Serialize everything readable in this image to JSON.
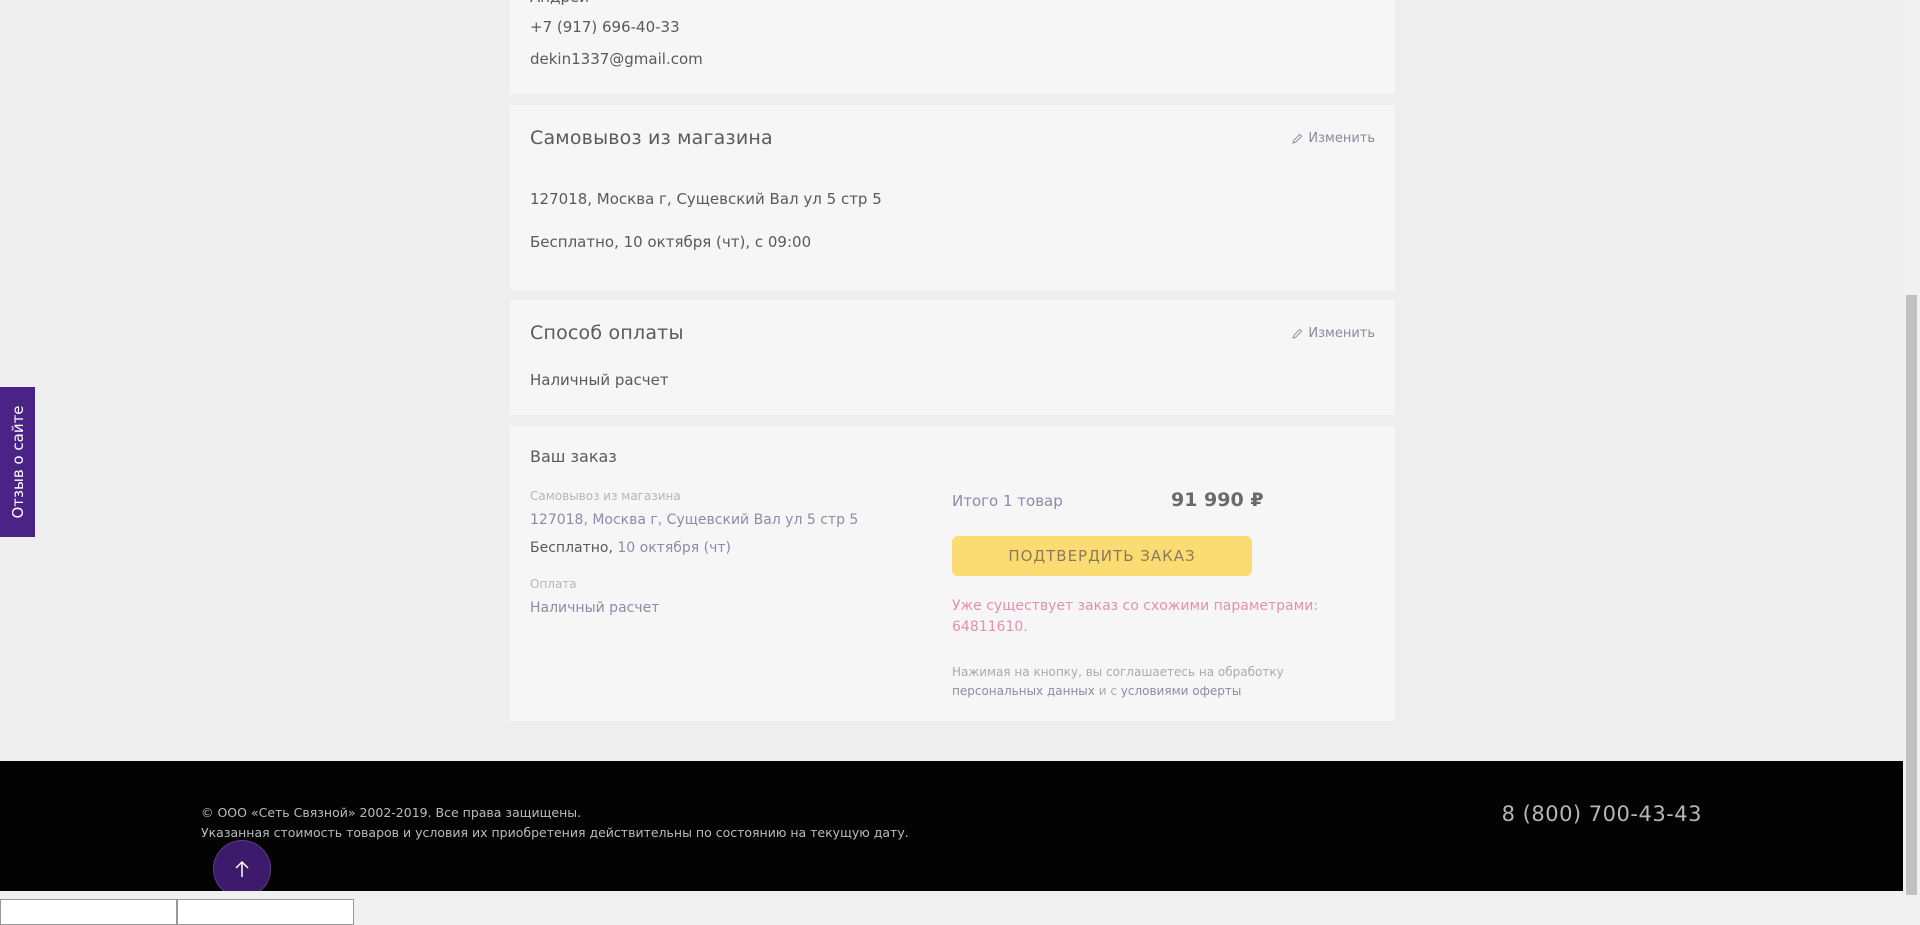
{
  "contact": {
    "phone": "+7 (917) 696-40-33",
    "email": "dekin1337@gmail.com"
  },
  "delivery": {
    "title": "Самовывоз из магазина",
    "edit_label": "Изменить",
    "address": "127018, Москва г, Сущевский Вал ул 5 стр 5",
    "terms": "Бесплатно, 10 октября (чт), с 09:00"
  },
  "payment": {
    "title": "Способ оплаты",
    "edit_label": "Изменить",
    "method": "Наличный расчет"
  },
  "order": {
    "title": "Ваш заказ",
    "delivery_caption": "Самовывоз из магазина",
    "delivery_address": "127018, Москва г, Сущевский Вал ул 5 стр 5",
    "delivery_free": "Бесплатно,",
    "delivery_date": "10 октября (чт)",
    "payment_caption": "Оплата",
    "payment_method": "Наличный расчет",
    "total_label": "Итого 1 товар",
    "total_price": "91 990 ₽",
    "confirm_label": "ПОДТВЕРДИТЬ ЗАКАЗ",
    "warning_text": "Уже существует заказ со схожими параметрами:",
    "warning_order": "64811610",
    "note_prefix": "Нажимая на кнопку, вы соглашаетесь на обработку",
    "note_link1": "персональных данных",
    "note_middle": "и с",
    "note_link2": "условиями оферты"
  },
  "footer": {
    "copyright": "© ООО «Сеть Связной» 2002-2019. Все права защищены.",
    "disclaimer": "Указанная стоимость товаров и условия их приобретения действительны по состоянию на текущую дату.",
    "phone": "8 (800) 700-43-43"
  },
  "feedback": {
    "label": "Отзыв о сайте"
  },
  "colors": {
    "accent": "#4b2286",
    "confirm_button": "#fbdc73",
    "warning": "#e58fb2",
    "footer": "#030303"
  }
}
